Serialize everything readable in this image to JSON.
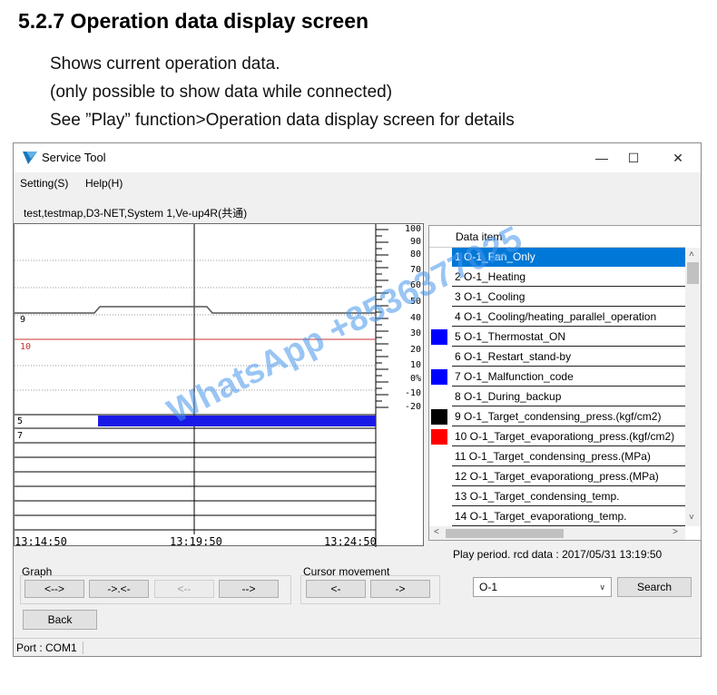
{
  "doc": {
    "section_title": "5.2.7  Operation data display screen",
    "lines": [
      "Shows current operation data.",
      "(only possible to show data while connected)",
      "See ”Play” function>Operation data display screen for details"
    ]
  },
  "window": {
    "title": "Service Tool",
    "controls": [
      "—",
      "☐",
      "✕"
    ],
    "icon": "service-tool-logo-icon"
  },
  "menu": [
    "Setting(S)",
    "Help(H)"
  ],
  "info_line": "test,testmap,D3-NET,System 1,Ve-up4R(共通)",
  "graph": {
    "scale_ticks": [
      "100",
      "90",
      "80",
      "70",
      "60",
      "50",
      "40",
      "30",
      "20",
      "10",
      "0%",
      "-10",
      "-20"
    ],
    "row_labels": [
      "9",
      "10",
      "5",
      "7"
    ],
    "time_labels": [
      "13:14:50",
      "13:19:50",
      "13:24:50"
    ],
    "trace_colors": {
      "row9": "#555555",
      "row10": "#cc3333",
      "row5": "#1a1ae6"
    }
  },
  "data_list": {
    "header": "Data item",
    "selected_index": 0,
    "items": [
      {
        "label": "1 O-1_Fan_Only",
        "color": ""
      },
      {
        "label": "2 O-1_Heating",
        "color": ""
      },
      {
        "label": "3 O-1_Cooling",
        "color": ""
      },
      {
        "label": "4 O-1_Cooling/heating_parallel_operation",
        "color": ""
      },
      {
        "label": "5 O-1_Thermostat_ON",
        "color": "#0000ff"
      },
      {
        "label": "6 O-1_Restart_stand-by",
        "color": ""
      },
      {
        "label": "7 O-1_Malfunction_code",
        "color": "#0000ff"
      },
      {
        "label": "8 O-1_During_backup",
        "color": ""
      },
      {
        "label": "9 O-1_Target_condensing_press.(kgf/cm2)",
        "color": "#000000"
      },
      {
        "label": "10 O-1_Target_evaporationg_press.(kgf/cm2)",
        "color": "#ff0000"
      },
      {
        "label": "11 O-1_Target_condensing_press.(MPa)",
        "color": ""
      },
      {
        "label": "12 O-1_Target_evaporationg_press.(MPa)",
        "color": ""
      },
      {
        "label": "13 O-1_Target_condensing_temp.",
        "color": ""
      },
      {
        "label": "14 O-1_Target_evaporationg_temp.",
        "color": ""
      }
    ],
    "scroll_up": "˄",
    "scroll_down": "˅",
    "scroll_left": "<",
    "scroll_right": ">"
  },
  "play_period": "Play period. rcd data : 2017/05/31 13:19:50",
  "graph_group": {
    "label": "Graph",
    "buttons": [
      {
        "label": "<-->",
        "enabled": true
      },
      {
        "label": "->.<-",
        "enabled": true
      },
      {
        "label": "<--",
        "enabled": false
      },
      {
        "label": "-->",
        "enabled": true
      }
    ]
  },
  "cursor_group": {
    "label": "Cursor movement",
    "buttons": [
      {
        "label": "<-",
        "enabled": true
      },
      {
        "label": "->",
        "enabled": true
      }
    ]
  },
  "unit_select": {
    "value": "O-1",
    "caret": "∨"
  },
  "search_label": "Search",
  "back_label": "Back",
  "status_port": "Port : COM1",
  "watermark": "WhatsApp +8536377025"
}
